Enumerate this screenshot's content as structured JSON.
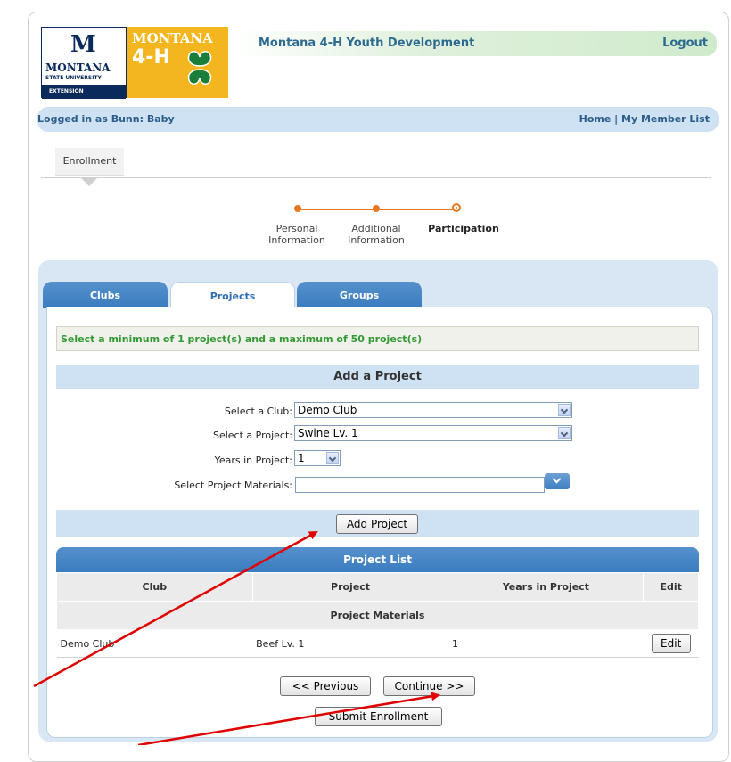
{
  "logo": {
    "msu_m": "M",
    "msu_word": "MONTANA",
    "msu_sub": "STATE UNIVERSITY",
    "msu_ext": "EXTENSION",
    "mt_word": "MONTANA",
    "mt_4h": "4-H"
  },
  "header": {
    "title": "Montana 4-H Youth Development",
    "logout": "Logout"
  },
  "login_bar": {
    "text": "Logged in as Bunn: Baby",
    "home": "Home",
    "sep": " | ",
    "member_list": "My Member List"
  },
  "enrollment_tab": "Enrollment",
  "steps": [
    {
      "line1": "Personal",
      "line2": "Information"
    },
    {
      "line1": "Additional",
      "line2": "Information"
    },
    {
      "line1": "Participation",
      "line2": ""
    }
  ],
  "tabs": {
    "clubs": "Clubs",
    "projects": "Projects",
    "groups": "Groups"
  },
  "requirement": "Select a minimum of 1 project(s) and a maximum of 50 project(s)",
  "add_project": {
    "heading": "Add a Project",
    "club_label": "Select a Club:",
    "club_value": "Demo Club",
    "project_label": "Select a Project:",
    "project_value": "Swine Lv. 1",
    "years_label": "Years in Project:",
    "years_value": "1",
    "materials_label": "Select Project Materials:",
    "materials_value": "",
    "add_button": "Add Project"
  },
  "project_list": {
    "heading": "Project List",
    "columns": [
      "Club",
      "Project",
      "Years in Project",
      "Edit"
    ],
    "sub_header": "Project Materials",
    "rows": [
      {
        "club": "Demo Club",
        "project": "Beef Lv. 1",
        "years": "1",
        "edit": "Edit"
      }
    ]
  },
  "footer": {
    "previous": "<< Previous",
    "continue": "Continue >>",
    "submit": "Submit Enrollment"
  },
  "colors": {
    "accent_blue": "#3a7cbf",
    "orange": "#e87722",
    "green_text": "#339933",
    "arrow_red": "#e00000"
  }
}
